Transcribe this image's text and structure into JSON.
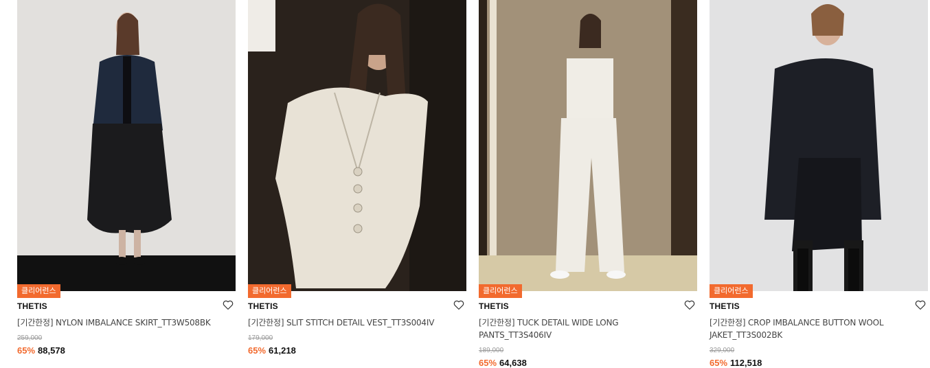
{
  "products": [
    {
      "badge": "클리어런스",
      "brand": "THETIS",
      "name": "[기간한정] NYLON IMBALANCE SKIRT_TT3W508BK",
      "original_price": "259,000",
      "discount": "65%",
      "price": "88,578",
      "image_icon": "model-black-skirt-image"
    },
    {
      "badge": "클리어런스",
      "brand": "THETIS",
      "name": "[기간한정] SLIT STITCH DETAIL VEST_TT3S004IV",
      "original_price": "179,000",
      "discount": "65%",
      "price": "61,218",
      "image_icon": "model-ivory-vest-image"
    },
    {
      "badge": "클리어런스",
      "brand": "THETIS",
      "name": "[기간한정] TUCK DETAIL WIDE LONG PANTS_TT3S406IV",
      "original_price": "189,000",
      "discount": "65%",
      "price": "64,638",
      "image_icon": "model-ivory-pants-image"
    },
    {
      "badge": "클리어런스",
      "brand": "THETIS",
      "name": "[기간한정] CROP IMBALANCE BUTTON WOOL JAKET_TT3S002BK",
      "original_price": "329,000",
      "discount": "65%",
      "price": "112,518",
      "image_icon": "model-black-jacket-image"
    }
  ],
  "colors": {
    "badge": "#f26a2e",
    "discount": "#f26a2e"
  },
  "wishlist_icon": "heart-outline-icon"
}
